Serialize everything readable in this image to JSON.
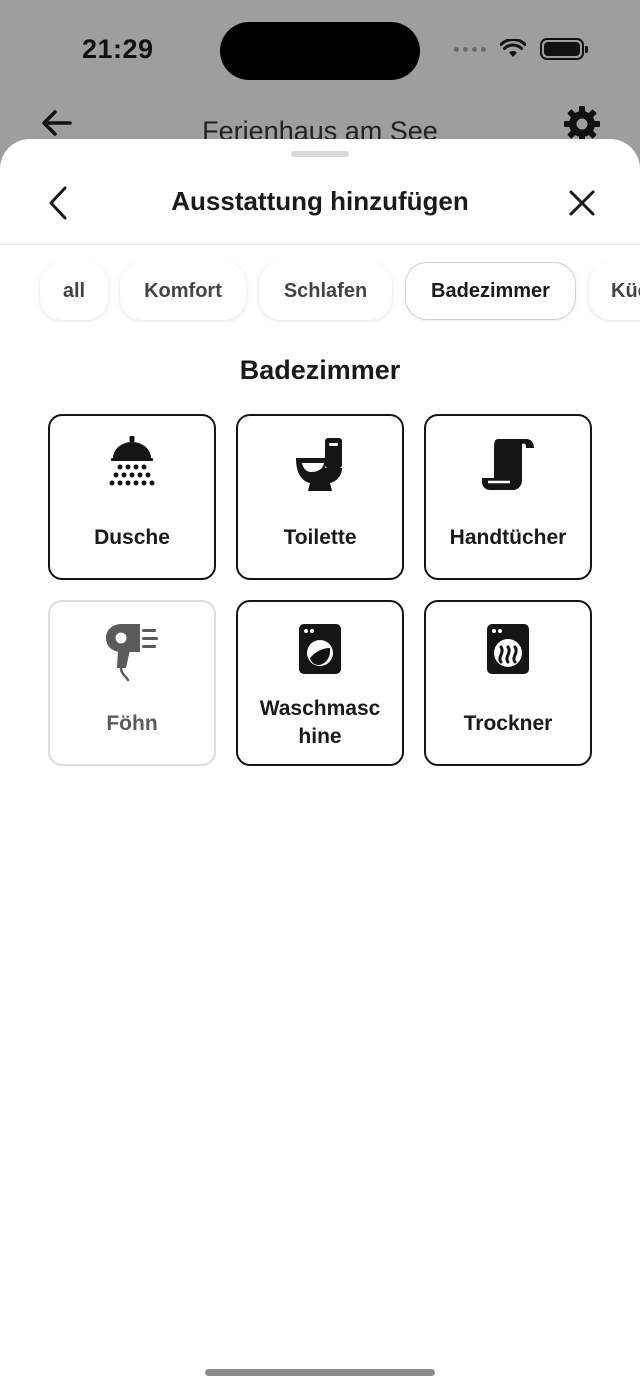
{
  "status_bar": {
    "time": "21:29"
  },
  "background_screen": {
    "title": "Ferienhaus am See"
  },
  "sheet": {
    "title": "Ausstattung hinzufügen",
    "categories": [
      {
        "label": "all",
        "active": false
      },
      {
        "label": "Komfort",
        "active": false
      },
      {
        "label": "Schlafen",
        "active": false
      },
      {
        "label": "Badezimmer",
        "active": true
      },
      {
        "label": "Küche",
        "active": false
      }
    ],
    "section_title": "Badezimmer",
    "items": [
      {
        "label": "Dusche",
        "icon": "shower-icon",
        "selected": true
      },
      {
        "label": "Toilette",
        "icon": "toilet-icon",
        "selected": true
      },
      {
        "label": "Handtücher",
        "icon": "towel-icon",
        "selected": true
      },
      {
        "label": "Föhn",
        "icon": "hair-dryer-icon",
        "selected": false
      },
      {
        "label": "Waschmaschine",
        "label_line1": "Waschmasc",
        "label_line2": "hine",
        "icon": "washing-machine-icon",
        "selected": true
      },
      {
        "label": "Trockner",
        "icon": "dryer-icon",
        "selected": true
      }
    ]
  },
  "colors": {
    "selected_border": "#141414",
    "unselected_border": "#dcdcdc",
    "backdrop": "#9e9e9e"
  }
}
